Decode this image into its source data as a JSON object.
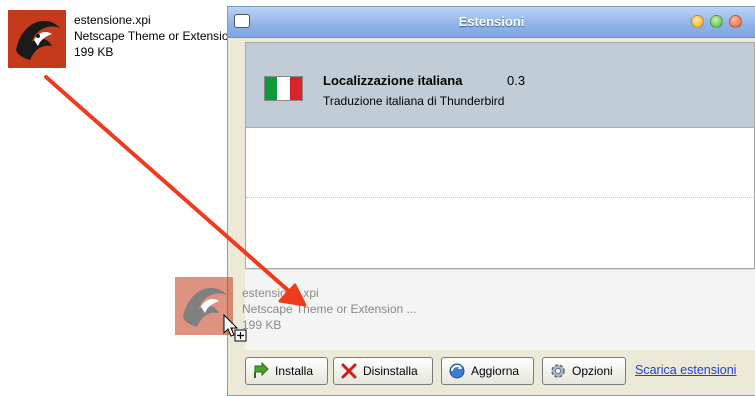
{
  "file": {
    "name": "estensione.xpi",
    "type": "Netscape Theme or Extension",
    "size": "199 KB"
  },
  "window": {
    "title": "Estensioni",
    "title_icon": "envelope-icon"
  },
  "extension": {
    "name": "Localizzazione italiana",
    "version": "0.3",
    "description": "Traduzione italiana di Thunderbird",
    "icon": "italian-flag-icon"
  },
  "drag_ghost": {
    "name": "estensione.xpi",
    "type": "Netscape Theme or Extension ...",
    "size": "199 KB"
  },
  "buttons": {
    "install": "Installa",
    "uninstall": "Disinstalla",
    "update": "Aggiorna",
    "options": "Opzioni",
    "download": "Scarica estensioni"
  },
  "colors": {
    "arrow": "#f03a1e",
    "selected_row": "#c0ccd6",
    "titlebar": "#8fb2e8",
    "link": "#1f3fd8"
  }
}
